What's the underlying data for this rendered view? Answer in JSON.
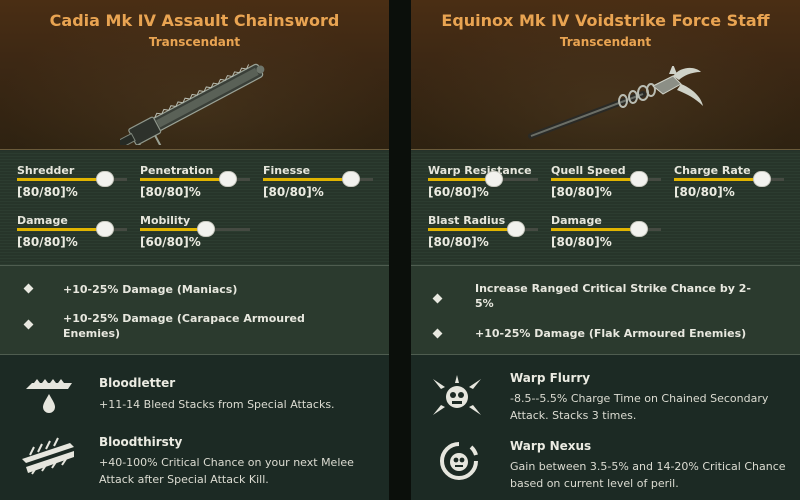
{
  "cards": [
    {
      "name": "Cadia Mk IV Assault Chainsword",
      "rarity": "Transcendant",
      "weapon_image": "chainsword-illustration",
      "stats": [
        {
          "label": "Shredder",
          "value": "[80/80]%",
          "level": 0.8
        },
        {
          "label": "Penetration",
          "value": "[80/80]%",
          "level": 0.8
        },
        {
          "label": "Finesse",
          "value": "[80/80]%",
          "level": 0.8
        },
        {
          "label": "Damage",
          "value": "[80/80]%",
          "level": 0.8
        },
        {
          "label": "Mobility",
          "value": "[60/80]%",
          "level": 0.6
        }
      ],
      "perks": [
        {
          "text": "+10-25% Damage (Maniacs)"
        },
        {
          "text": "+10-25% Damage (Carapace Armoured Enemies)"
        }
      ],
      "blessings": [
        {
          "icon": "bloodletter-icon",
          "title": "Bloodletter",
          "description": "+11-14 Bleed Stacks from Special Attacks."
        },
        {
          "icon": "bloodthirsty-icon",
          "title": "Bloodthirsty",
          "description": "+40-100% Critical Chance on your next Melee Attack after Special Attack Kill."
        }
      ]
    },
    {
      "name": "Equinox Mk IV Voidstrike Force Staff",
      "rarity": "Transcendant",
      "weapon_image": "force-staff-illustration",
      "stats": [
        {
          "label": "Warp Resistance",
          "value": "[60/80]%",
          "level": 0.6
        },
        {
          "label": "Quell Speed",
          "value": "[80/80]%",
          "level": 0.8
        },
        {
          "label": "Charge Rate",
          "value": "[80/80]%",
          "level": 0.8
        },
        {
          "label": "Blast Radius",
          "value": "[80/80]%",
          "level": 0.8
        },
        {
          "label": "Damage",
          "value": "[80/80]%",
          "level": 0.8
        }
      ],
      "perks": [
        {
          "text": "Increase Ranged Critical Strike Chance by 2-5%"
        },
        {
          "text": "+10-25% Damage (Flak Armoured Enemies)"
        }
      ],
      "blessings": [
        {
          "icon": "warp-flurry-icon",
          "title": "Warp Flurry",
          "description": "-8.5--5.5% Charge Time on Chained Secondary Attack. Stacks 3 times."
        },
        {
          "icon": "warp-nexus-icon",
          "title": "Warp Nexus",
          "description": "Gain between 3.5-5% and 14-20% Critical Chance based on current level of peril."
        }
      ]
    }
  ],
  "colors": {
    "name_gold": "#e9a452",
    "stat_fill": "#e1b400",
    "card_bg": "#25322a",
    "hero_brown": "#3d2814"
  }
}
